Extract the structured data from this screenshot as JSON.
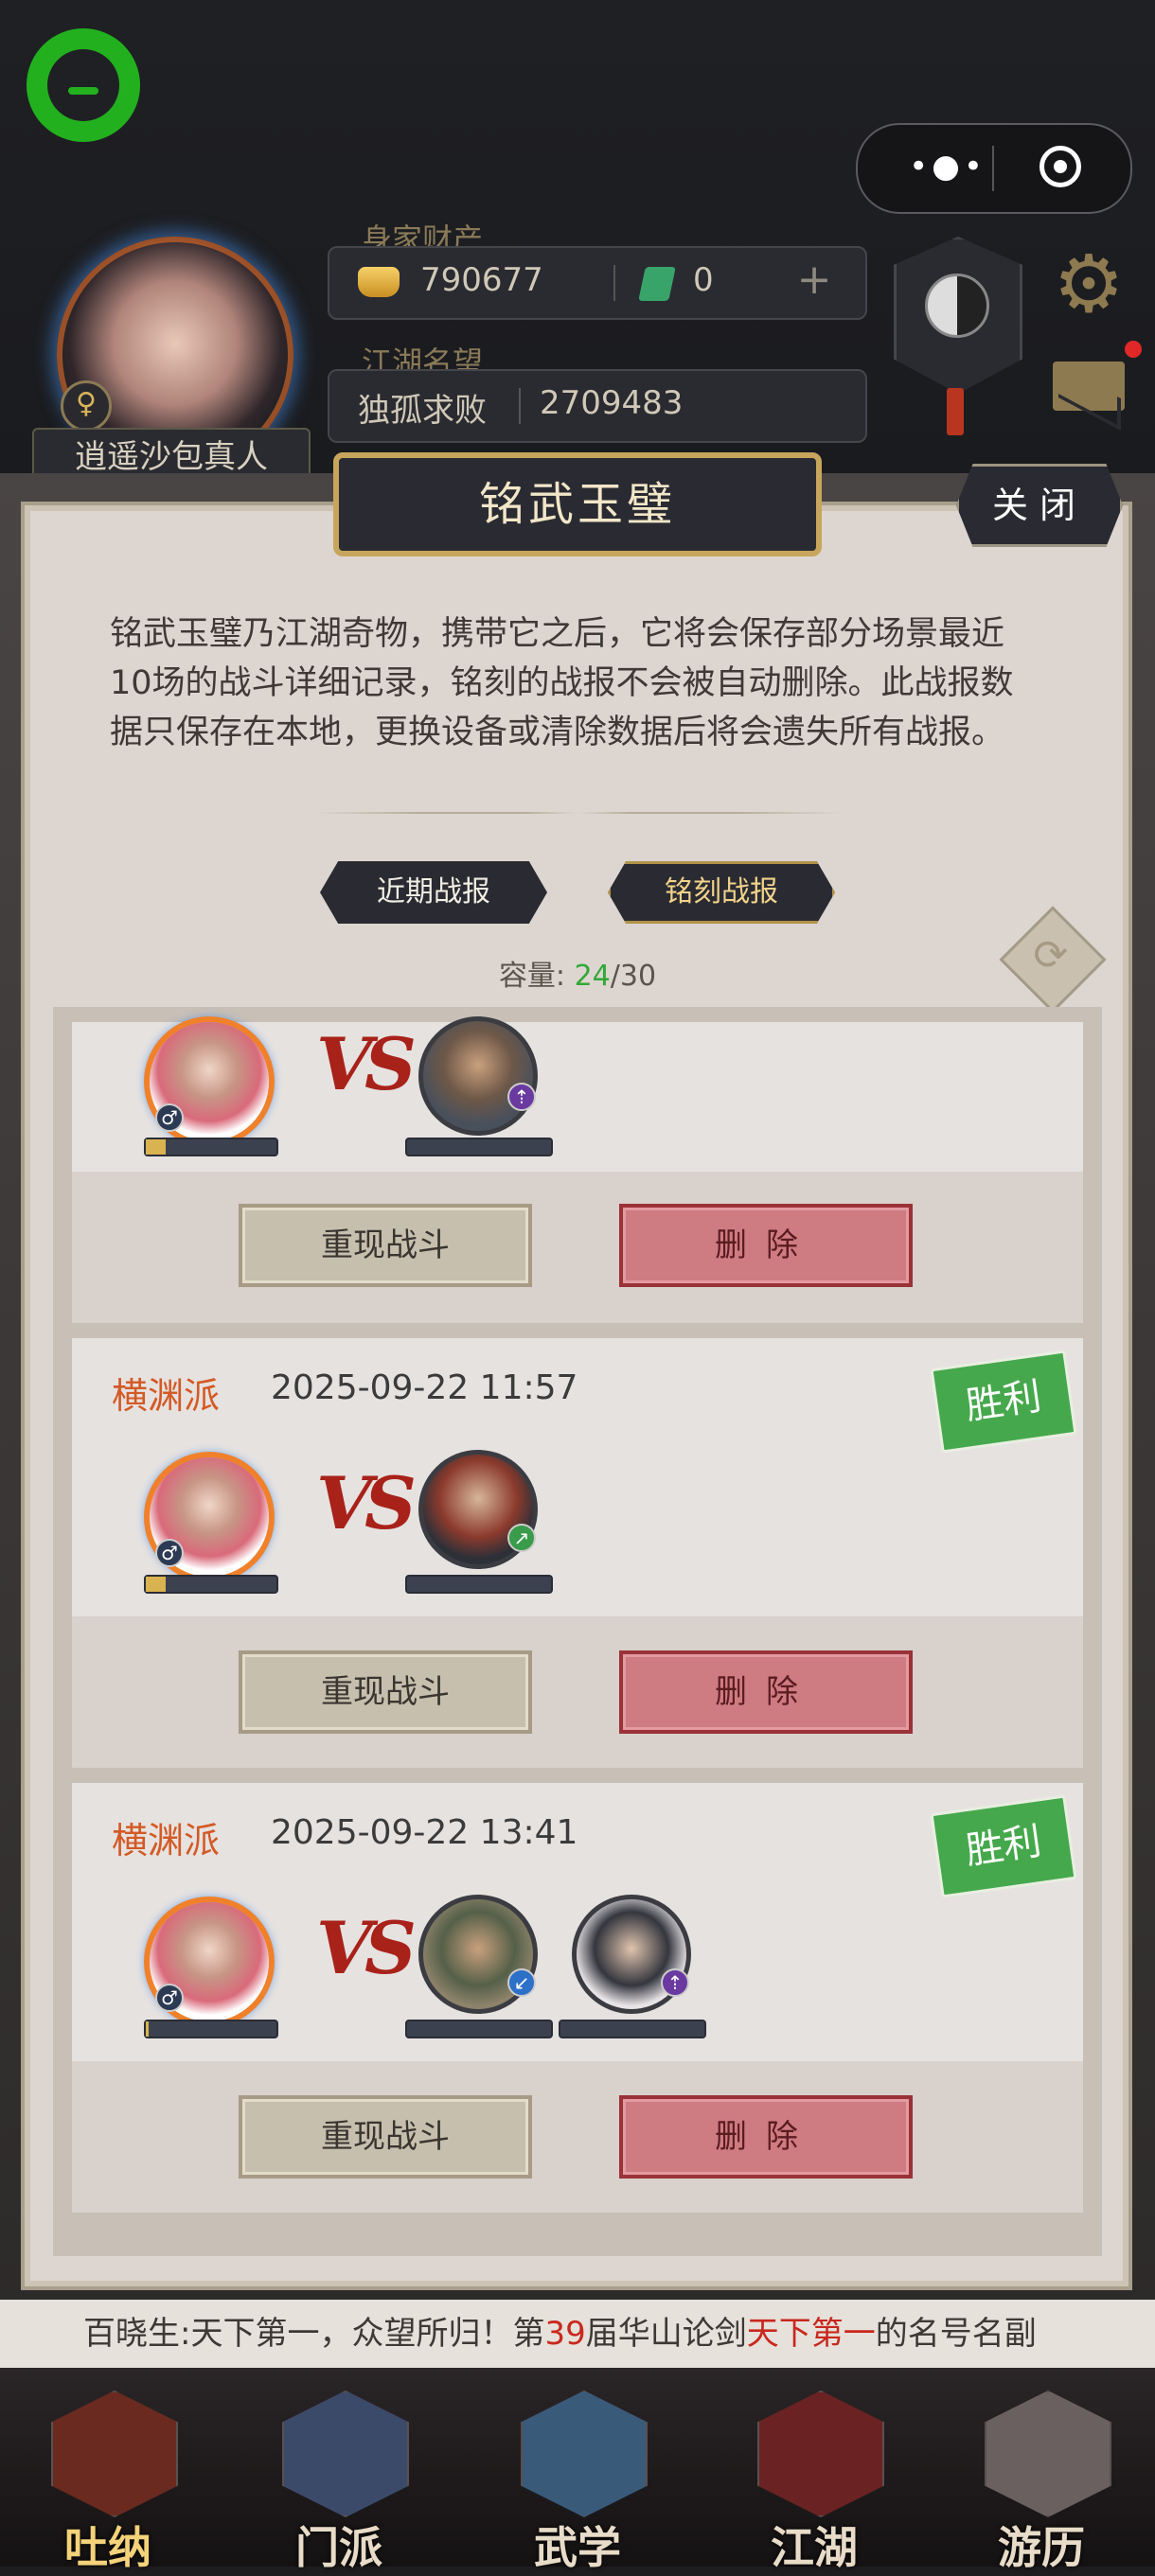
{
  "header": {
    "player_name": "逍遥沙包真人",
    "wealth_label": "身家财产",
    "gold": "790677",
    "jade": "0",
    "plus": "+",
    "fame_label": "江湖名望",
    "fame_title": "独孤求败",
    "fame_value": "2709483",
    "gender_symbol": "♀"
  },
  "dialog": {
    "title": "铭武玉璧",
    "close_label": "关闭",
    "intro": "铭武玉璧乃江湖奇物，携带它之后，它将会保存部分场景最近10场的战斗详细记录，铭刻的战报不会被自动删除。此战报数据只保存在本地，更换设备或清除数据后将会遗失所有战报。",
    "tabs": [
      "近期战报",
      "铭刻战报"
    ],
    "active_tab": "铭刻战报",
    "capacity_label": "容量:",
    "capacity_current": "24",
    "capacity_max": "/30",
    "replay_label": "重现战斗",
    "delete_label": "删除",
    "vs_text": "VS",
    "records": [
      {
        "sect": "",
        "datetime": "",
        "result": "",
        "player_hp": 0.15,
        "enemy_hp": [
          0
        ]
      },
      {
        "sect": "横渊派",
        "datetime": "2025-09-22 11:57",
        "result": "胜利",
        "player_hp": 0.15,
        "enemy_hp": [
          0
        ]
      },
      {
        "sect": "横渊派",
        "datetime": "2025-09-22 13:41",
        "result": "胜利",
        "player_hp": 0.02,
        "enemy_hp": [
          0,
          0
        ]
      }
    ]
  },
  "ticker": {
    "prefix": "百晓生:天下第一，众望所归！第",
    "number": "39",
    "middle": "届华山论剑",
    "highlight": "天下第一",
    "suffix": "的名号名副"
  },
  "nav": [
    "吐纳",
    "门派",
    "武学",
    "江湖",
    "游历"
  ],
  "colors": {
    "accent_gold": "#c8a55c",
    "win_green": "#46a84c",
    "sect_orange": "#d35a25",
    "delete_red": "#cf7b82"
  }
}
